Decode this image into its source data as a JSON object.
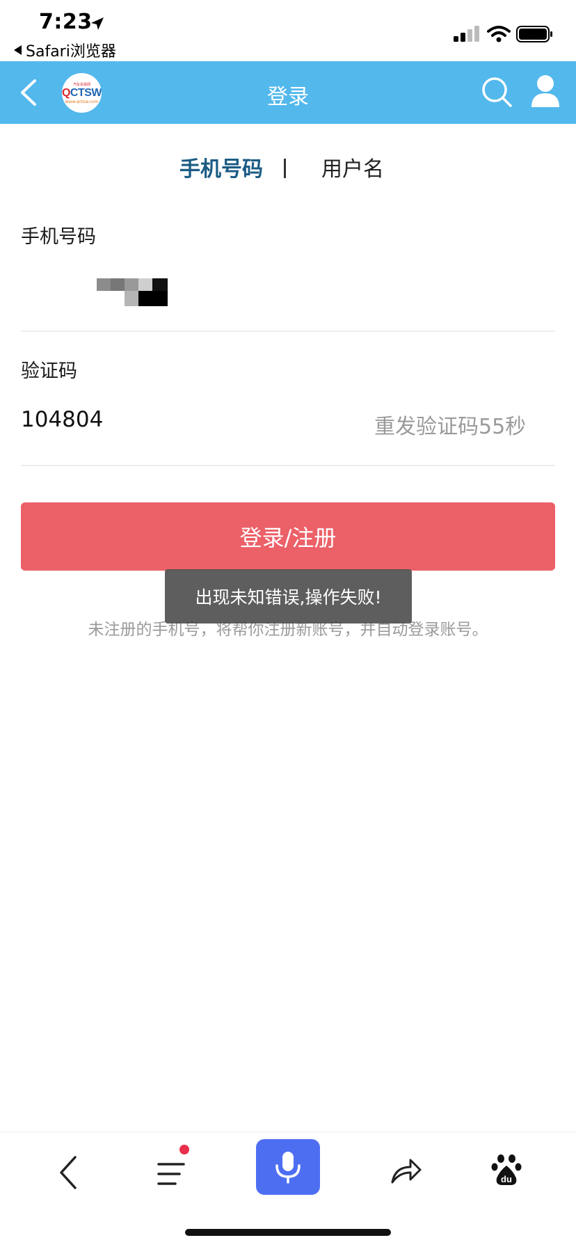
{
  "status_bar": {
    "time": "7:23",
    "back_app": "Safari浏览器"
  },
  "header": {
    "title": "登录",
    "logo": {
      "top_text": "汽车贸易网",
      "main_q": "Q",
      "main_rest": "CTSW",
      "sub_text": "www.qctsw.com"
    }
  },
  "tabs": {
    "phone": "手机号码",
    "username": "用户名"
  },
  "form": {
    "phone_label": "手机号码",
    "code_label": "验证码",
    "code_value": "104804",
    "resend": "重发验证码55秒"
  },
  "login_button": "登录/注册",
  "toast": "出现未知错误,操作失败!",
  "hint": "未注册的手机号，将帮你注册新账号，并自动登录账号。",
  "colors": {
    "header_bg": "#53b8ec",
    "primary_button": "#ec6068",
    "active_tab": "#1b5c85",
    "voice_button": "#4e6ef2",
    "notification_dot": "#ea2f4b"
  }
}
